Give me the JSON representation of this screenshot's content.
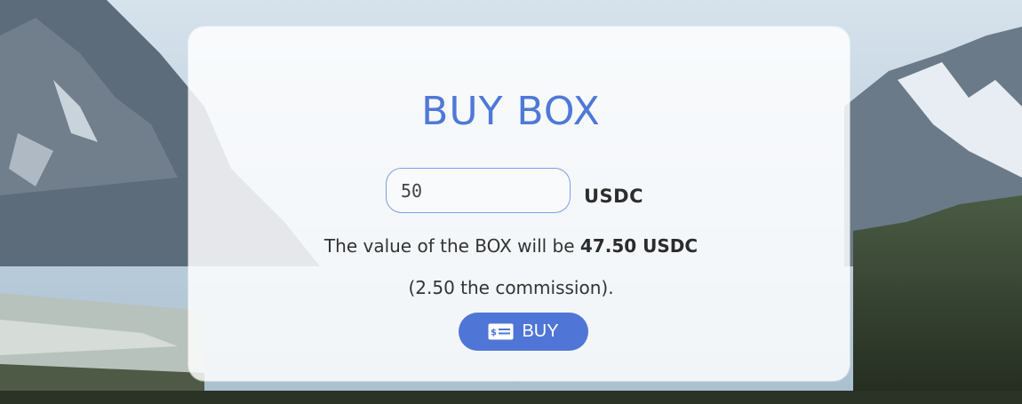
{
  "page": {
    "title": "BUY BOX",
    "amount_input": {
      "value": "50"
    },
    "currency": "USDC",
    "value_text_prefix": "The value of the BOX will be",
    "box_value": "47.50 USDC",
    "commission_text": "(2.50 the commission).",
    "buy_button_label": "BUY",
    "buy_button_icon": "cash-icon"
  },
  "colors": {
    "accent": "#4f76d6",
    "title": "#4f78d8",
    "input_border": "#7d9ee6"
  }
}
